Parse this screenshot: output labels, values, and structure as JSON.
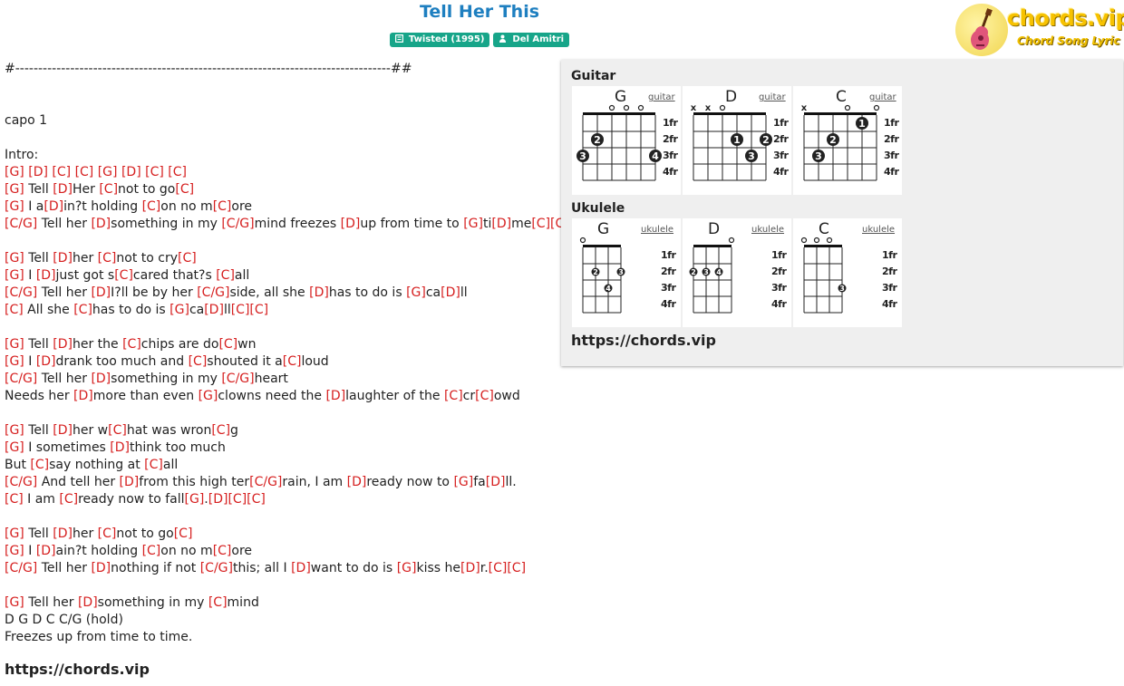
{
  "song": {
    "title": "Tell Her This",
    "album_badge": "Twisted (1995)",
    "artist_badge": "Del Amitri"
  },
  "logo": {
    "text": "chords.vip",
    "subtitle": "Chord Song Lyric"
  },
  "sheet": [
    [
      {
        "t": "#----------------------------------------------------------------------------------##"
      }
    ],
    [],
    [],
    [
      {
        "t": "capo 1"
      }
    ],
    [],
    [
      {
        "t": "Intro:"
      }
    ],
    [
      {
        "c": "[G]"
      },
      {
        "t": " "
      },
      {
        "c": "[D]"
      },
      {
        "t": " "
      },
      {
        "c": "[C]"
      },
      {
        "t": " "
      },
      {
        "c": "[C]"
      },
      {
        "t": " "
      },
      {
        "c": "[G]"
      },
      {
        "t": " "
      },
      {
        "c": "[D]"
      },
      {
        "t": " "
      },
      {
        "c": "[C]"
      },
      {
        "t": " "
      },
      {
        "c": "[C]"
      }
    ],
    [
      {
        "c": "[G]"
      },
      {
        "t": " Tell "
      },
      {
        "c": "[D]"
      },
      {
        "t": "Her "
      },
      {
        "c": "[C]"
      },
      {
        "t": "not to go"
      },
      {
        "c": "[C]"
      }
    ],
    [
      {
        "c": "[G]"
      },
      {
        "t": " I a"
      },
      {
        "c": "[D]"
      },
      {
        "t": "in?t holding "
      },
      {
        "c": "[C]"
      },
      {
        "t": "on no m"
      },
      {
        "c": "[C]"
      },
      {
        "t": "ore"
      }
    ],
    [
      {
        "c": "[C/G]"
      },
      {
        "t": " Tell her "
      },
      {
        "c": "[D]"
      },
      {
        "t": "something in my "
      },
      {
        "c": "[C/G]"
      },
      {
        "t": "mind freezes "
      },
      {
        "c": "[D]"
      },
      {
        "t": "up from time to "
      },
      {
        "c": "[G]"
      },
      {
        "t": "ti"
      },
      {
        "c": "[D]"
      },
      {
        "t": "me"
      },
      {
        "c": "[C]"
      },
      {
        "c": "[C]"
      }
    ],
    [],
    [
      {
        "c": "[G]"
      },
      {
        "t": " Tell "
      },
      {
        "c": "[D]"
      },
      {
        "t": "her "
      },
      {
        "c": "[C]"
      },
      {
        "t": "not to cry"
      },
      {
        "c": "[C]"
      }
    ],
    [
      {
        "c": "[G]"
      },
      {
        "t": " I "
      },
      {
        "c": "[D]"
      },
      {
        "t": "just got s"
      },
      {
        "c": "[C]"
      },
      {
        "t": "cared that?s "
      },
      {
        "c": "[C]"
      },
      {
        "t": "all"
      }
    ],
    [
      {
        "c": "[C/G]"
      },
      {
        "t": " Tell her "
      },
      {
        "c": "[D]"
      },
      {
        "t": "I?ll be by her "
      },
      {
        "c": "[C/G]"
      },
      {
        "t": "side, all she "
      },
      {
        "c": "[D]"
      },
      {
        "t": "has to do is "
      },
      {
        "c": "[G]"
      },
      {
        "t": "ca"
      },
      {
        "c": "[D]"
      },
      {
        "t": "ll"
      }
    ],
    [
      {
        "c": "[C]"
      },
      {
        "t": " All she "
      },
      {
        "c": "[C]"
      },
      {
        "t": "has to do is "
      },
      {
        "c": "[G]"
      },
      {
        "t": "ca"
      },
      {
        "c": "[D]"
      },
      {
        "t": "ll"
      },
      {
        "c": "[C]"
      },
      {
        "c": "[C]"
      }
    ],
    [],
    [
      {
        "c": "[G]"
      },
      {
        "t": " Tell "
      },
      {
        "c": "[D]"
      },
      {
        "t": "her the "
      },
      {
        "c": "[C]"
      },
      {
        "t": "chips are do"
      },
      {
        "c": "[C]"
      },
      {
        "t": "wn"
      }
    ],
    [
      {
        "c": "[G]"
      },
      {
        "t": " I "
      },
      {
        "c": "[D]"
      },
      {
        "t": "drank too much and "
      },
      {
        "c": "[C]"
      },
      {
        "t": "shouted it a"
      },
      {
        "c": "[C]"
      },
      {
        "t": "loud"
      }
    ],
    [
      {
        "c": "[C/G]"
      },
      {
        "t": " Tell her "
      },
      {
        "c": "[D]"
      },
      {
        "t": "something in my "
      },
      {
        "c": "[C/G]"
      },
      {
        "t": "heart"
      }
    ],
    [
      {
        "t": "Needs her "
      },
      {
        "c": "[D]"
      },
      {
        "t": "more than even "
      },
      {
        "c": "[G]"
      },
      {
        "t": "clowns need the "
      },
      {
        "c": "[D]"
      },
      {
        "t": "laughter of the "
      },
      {
        "c": "[C]"
      },
      {
        "t": "cr"
      },
      {
        "c": "[C]"
      },
      {
        "t": "owd"
      }
    ],
    [],
    [
      {
        "c": "[G]"
      },
      {
        "t": " Tell "
      },
      {
        "c": "[D]"
      },
      {
        "t": "her w"
      },
      {
        "c": "[C]"
      },
      {
        "t": "hat was wron"
      },
      {
        "c": "[C]"
      },
      {
        "t": "g"
      }
    ],
    [
      {
        "c": "[G]"
      },
      {
        "t": " I sometimes "
      },
      {
        "c": "[D]"
      },
      {
        "t": "think too much"
      }
    ],
    [
      {
        "t": "But "
      },
      {
        "c": "[C]"
      },
      {
        "t": "say nothing at "
      },
      {
        "c": "[C]"
      },
      {
        "t": "all"
      }
    ],
    [
      {
        "c": "[C/G]"
      },
      {
        "t": " And tell her "
      },
      {
        "c": "[D]"
      },
      {
        "t": "from this high ter"
      },
      {
        "c": "[C/G]"
      },
      {
        "t": "rain, I am "
      },
      {
        "c": "[D]"
      },
      {
        "t": "ready now to "
      },
      {
        "c": "[G]"
      },
      {
        "t": "fa"
      },
      {
        "c": "[D]"
      },
      {
        "t": "ll."
      }
    ],
    [
      {
        "c": "[C]"
      },
      {
        "t": " I am "
      },
      {
        "c": "[C]"
      },
      {
        "t": "ready now to fall"
      },
      {
        "c": "[G]"
      },
      {
        "t": "."
      },
      {
        "c": "[D]"
      },
      {
        "c": "[C]"
      },
      {
        "c": "[C]"
      }
    ],
    [],
    [
      {
        "c": "[G]"
      },
      {
        "t": " Tell "
      },
      {
        "c": "[D]"
      },
      {
        "t": "her "
      },
      {
        "c": "[C]"
      },
      {
        "t": "not to go"
      },
      {
        "c": "[C]"
      }
    ],
    [
      {
        "c": "[G]"
      },
      {
        "t": " I "
      },
      {
        "c": "[D]"
      },
      {
        "t": "ain?t holding "
      },
      {
        "c": "[C]"
      },
      {
        "t": "on no m"
      },
      {
        "c": "[C]"
      },
      {
        "t": "ore"
      }
    ],
    [
      {
        "c": "[C/G]"
      },
      {
        "t": " Tell her "
      },
      {
        "c": "[D]"
      },
      {
        "t": "nothing if not "
      },
      {
        "c": "[C/G]"
      },
      {
        "t": "this; all I "
      },
      {
        "c": "[D]"
      },
      {
        "t": "want to do is "
      },
      {
        "c": "[G]"
      },
      {
        "t": "kiss he"
      },
      {
        "c": "[D]"
      },
      {
        "t": "r."
      },
      {
        "c": "[C]"
      },
      {
        "c": "[C]"
      }
    ],
    [],
    [
      {
        "c": "[G]"
      },
      {
        "t": " Tell her "
      },
      {
        "c": "[D]"
      },
      {
        "t": "something in my "
      },
      {
        "c": "[C]"
      },
      {
        "t": "mind"
      }
    ],
    [
      {
        "t": "D G D C C/G (hold)"
      }
    ],
    [
      {
        "t": "Freezes up from time to time."
      }
    ]
  ],
  "footer_url": "https://chords.vip",
  "panel": {
    "guitar_label": "Guitar",
    "ukulele_label": "Ukulele",
    "url": "https://chords.vip",
    "fret_labels": [
      "1fr",
      "2fr",
      "3fr",
      "4fr"
    ],
    "guitar": [
      {
        "name": "G",
        "link": "guitar",
        "strings": 6,
        "markers": [
          "",
          "",
          "o",
          "o",
          "o",
          ""
        ],
        "dots": [
          {
            "s": 0,
            "f": 3,
            "n": "3"
          },
          {
            "s": 1,
            "f": 2,
            "n": "2"
          },
          {
            "s": 5,
            "f": 3,
            "n": "4"
          }
        ]
      },
      {
        "name": "D",
        "link": "guitar",
        "strings": 6,
        "markers": [
          "x",
          "x",
          "o",
          "",
          "",
          ""
        ],
        "dots": [
          {
            "s": 3,
            "f": 2,
            "n": "1"
          },
          {
            "s": 4,
            "f": 3,
            "n": "3"
          },
          {
            "s": 5,
            "f": 2,
            "n": "2"
          }
        ]
      },
      {
        "name": "C",
        "link": "guitar",
        "strings": 6,
        "markers": [
          "x",
          "",
          "",
          "o",
          "",
          "o"
        ],
        "dots": [
          {
            "s": 1,
            "f": 3,
            "n": "3"
          },
          {
            "s": 2,
            "f": 2,
            "n": "2"
          },
          {
            "s": 4,
            "f": 1,
            "n": "1"
          }
        ]
      }
    ],
    "ukulele": [
      {
        "name": "G",
        "link": "ukulele",
        "strings": 4,
        "markers": [
          "o",
          "",
          "",
          ""
        ],
        "dots": [
          {
            "s": 1,
            "f": 2,
            "n": "2"
          },
          {
            "s": 2,
            "f": 3,
            "n": "4"
          },
          {
            "s": 3,
            "f": 2,
            "n": "3"
          }
        ]
      },
      {
        "name": "D",
        "link": "ukulele",
        "strings": 4,
        "markers": [
          "",
          "",
          "",
          "o"
        ],
        "dots": [
          {
            "s": 0,
            "f": 2,
            "n": "2"
          },
          {
            "s": 1,
            "f": 2,
            "n": "3"
          },
          {
            "s": 2,
            "f": 2,
            "n": "4"
          }
        ]
      },
      {
        "name": "C",
        "link": "ukulele",
        "strings": 4,
        "markers": [
          "o",
          "o",
          "o",
          ""
        ],
        "dots": [
          {
            "s": 3,
            "f": 3,
            "n": "3"
          }
        ]
      }
    ]
  }
}
